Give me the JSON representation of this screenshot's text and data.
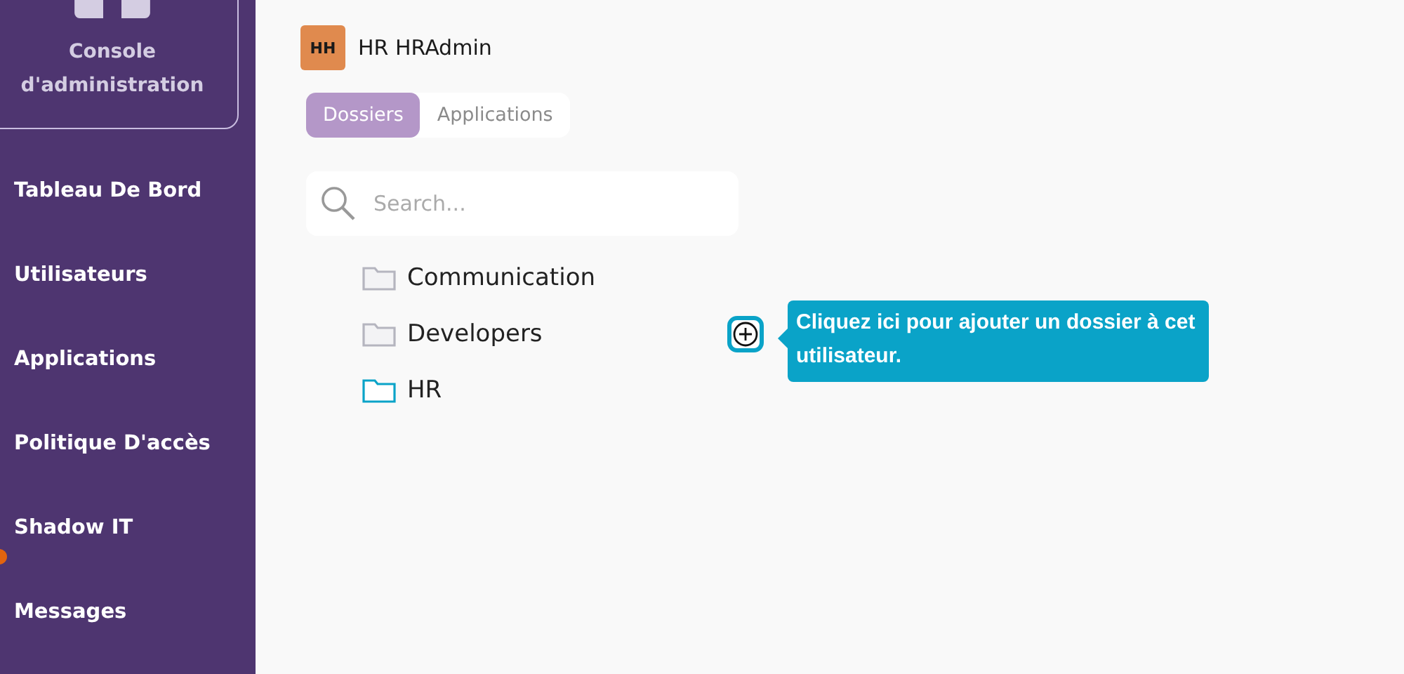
{
  "sidebar": {
    "console_label": "Console\nd'administration",
    "items": [
      {
        "label": "Tableau De Bord",
        "badge": false
      },
      {
        "label": "Utilisateurs",
        "badge": false
      },
      {
        "label": "Applications",
        "badge": false
      },
      {
        "label": "Politique D'accès",
        "badge": false
      },
      {
        "label": "Shadow IT",
        "badge": true
      },
      {
        "label": "Messages",
        "badge": false
      }
    ]
  },
  "user": {
    "initials": "HH",
    "name": "HR HRAdmin"
  },
  "tabs": [
    {
      "label": "Dossiers",
      "selected": true
    },
    {
      "label": "Applications",
      "selected": false
    }
  ],
  "search": {
    "placeholder": "Search..."
  },
  "folders": [
    {
      "name": "Communication",
      "selected": false
    },
    {
      "name": "Developers",
      "selected": false,
      "add_button": true
    },
    {
      "name": "HR",
      "selected": true
    }
  ],
  "tooltip": {
    "text": "Cliquez ici pour ajouter un dossier à cet utilisateur."
  }
}
